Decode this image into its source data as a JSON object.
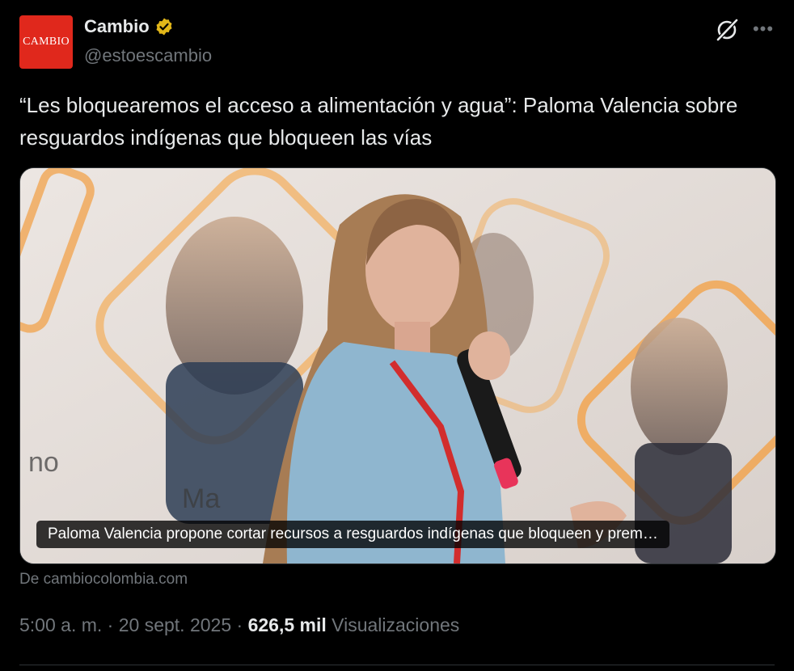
{
  "author": {
    "avatar_text": "CAMBIO",
    "display_name": "Cambio",
    "handle": "@estoescambio",
    "verified_badge": "gold-checkmark"
  },
  "tweet": {
    "text": "“Les bloquearemos el acceso a alimentación y agua”: Paloma Valencia sobre resguardos indígenas que bloqueen las vías"
  },
  "card": {
    "caption": "Paloma Valencia propone cortar recursos a resguardos indígenas que bloqueen y prem…",
    "source": "De cambiocolombia.com",
    "background_text_left": "no",
    "background_text_bottom": "Ma"
  },
  "meta": {
    "time": "5:00 a. m.",
    "separator": "·",
    "date": "20 sept. 2025",
    "views_count": "626,5 mil",
    "views_label": "Visualizaciones"
  },
  "icons": {
    "grok": "grok-icon",
    "more": "more-icon",
    "verified": "verified-icon"
  },
  "colors": {
    "background": "#000000",
    "text": "#e7e9ea",
    "muted": "#71767b",
    "accent_orange": "#f29a2e",
    "brand_red": "#e0281c",
    "verified_gold": "#e2b719"
  }
}
